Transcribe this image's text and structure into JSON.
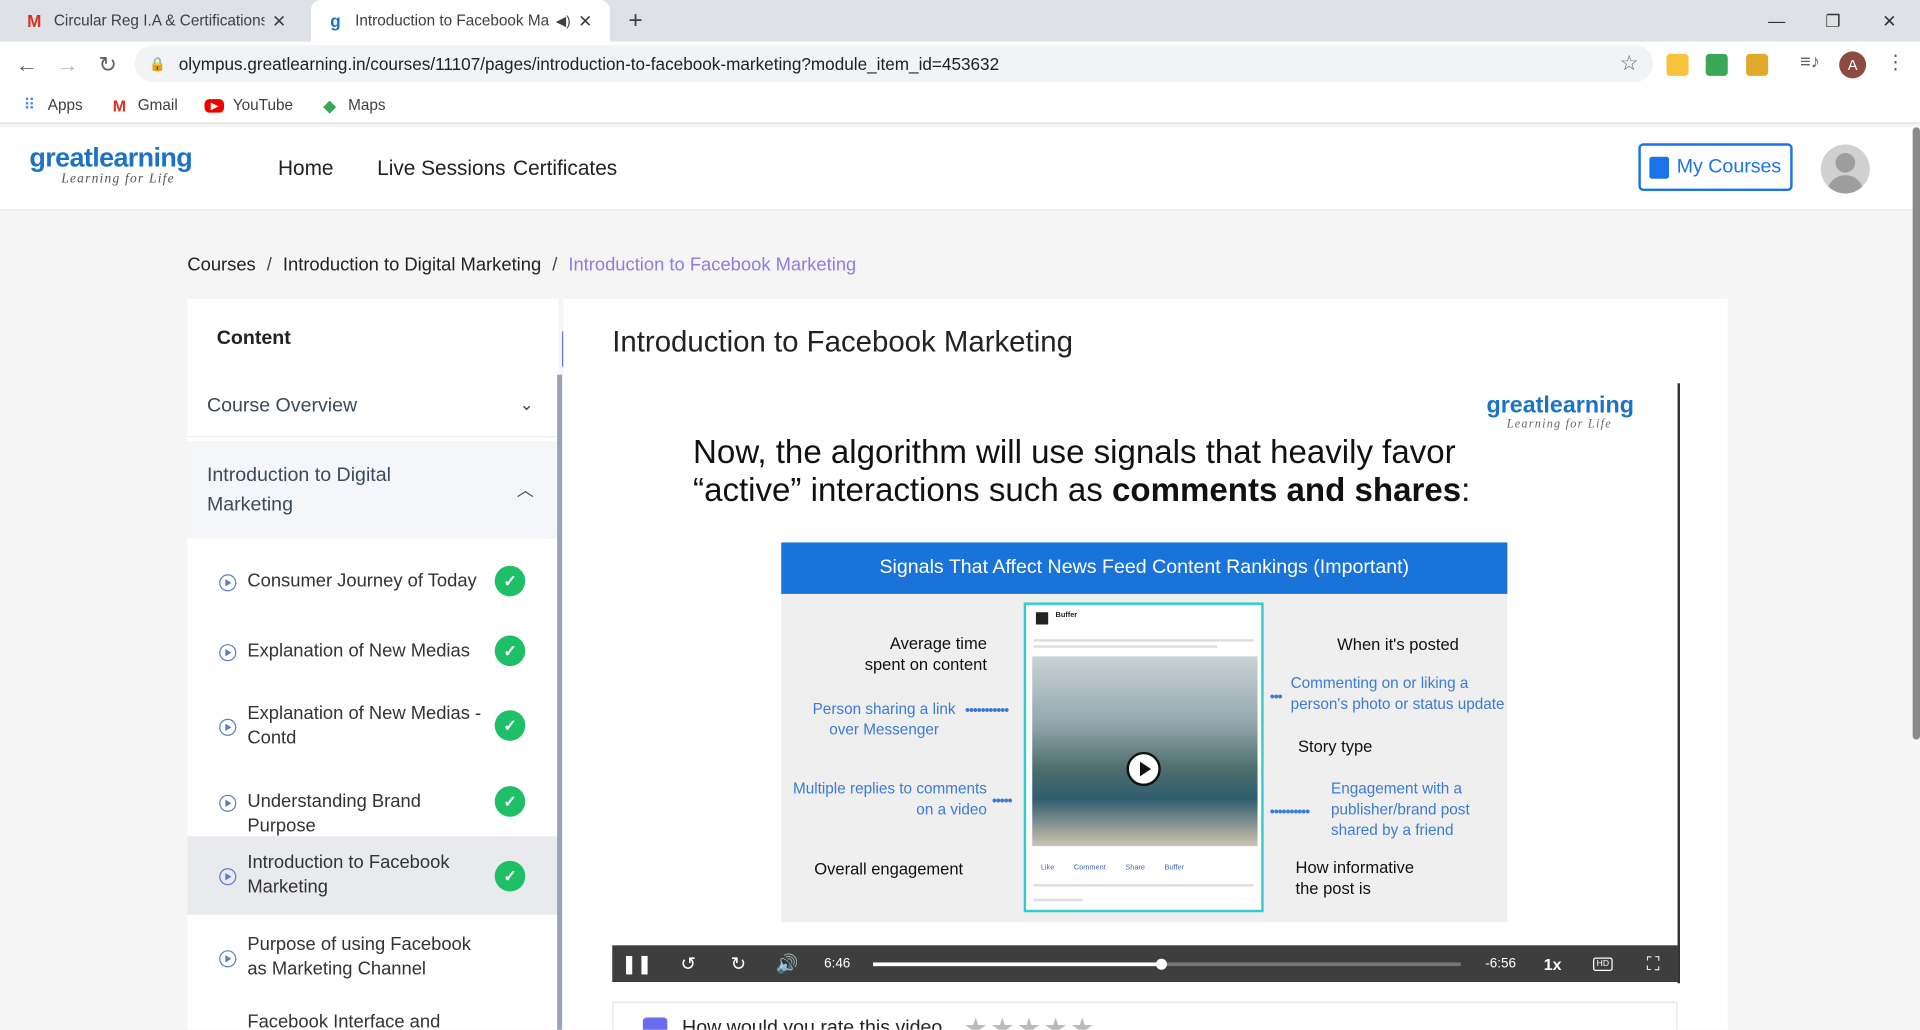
{
  "browser": {
    "tabs": [
      {
        "title": "Circular Reg I.A & Certifications/",
        "icon": "gmail-icon"
      },
      {
        "title": "Introduction to Facebook Ma",
        "icon": "greatlearning-icon",
        "audio": true
      }
    ],
    "new_tab": "+",
    "url": "olympus.greatlearning.in/courses/11107/pages/introduction-to-facebook-marketing?module_item_id=453632",
    "profile_initial": "A",
    "bookmarks": [
      "Apps",
      "Gmail",
      "YouTube",
      "Maps"
    ]
  },
  "site": {
    "logo_main": "greatlearning",
    "logo_tagline": "Learning for Life",
    "nav": [
      "Home",
      "Live Sessions",
      "Certificates"
    ],
    "my_courses": "My Courses"
  },
  "breadcrumb": {
    "root": "Courses",
    "course": "Introduction to Digital Marketing",
    "current": "Introduction to Facebook Marketing",
    "sep": "/"
  },
  "sidebar": {
    "title": "Content",
    "modules": [
      {
        "label": "Course Overview",
        "expanded": false
      },
      {
        "label": "Introduction to Digital Marketing",
        "expanded": true
      }
    ],
    "items": [
      {
        "label": "Consumer Journey of Today",
        "done": true
      },
      {
        "label": "Explanation of New Medias",
        "done": true
      },
      {
        "label": "Explanation of New Medias - Contd",
        "done": true
      },
      {
        "label": "Understanding Brand Purpose",
        "done": true
      },
      {
        "label": "Introduction to Facebook Marketing",
        "done": true,
        "active": true
      },
      {
        "label": "Purpose of using Facebook as Marketing Channel",
        "done": false
      },
      {
        "label": "Facebook Interface and Types of",
        "done": false
      }
    ]
  },
  "lesson": {
    "title": "Introduction to Facebook Marketing"
  },
  "slide": {
    "logo_main": "greatlearning",
    "logo_tagline": "Learning for Life",
    "heading_part1": "Now, the algorithm will use signals that heavily favor “active” interactions such as ",
    "heading_bold": "comments and shares",
    "heading_end": ":",
    "panel_title": "Signals That Affect News Feed Content Rankings (Important)",
    "left_signals": {
      "avg_time": "Average time spent on content",
      "sharing": "Person sharing a link over Messenger",
      "replies": "Multiple replies to comments on a video",
      "overall": "Overall engagement"
    },
    "right_signals": {
      "when": "When it's posted",
      "commenting": "Commenting on or liking a person's photo or status update",
      "story": "Story type",
      "engagement": "Engagement with a publisher/brand post shared by a friend",
      "informative": "How informative the post is"
    },
    "phone": {
      "page": "Buffer",
      "actions": [
        "Like",
        "Comment",
        "Share",
        "Buffer"
      ]
    }
  },
  "player": {
    "elapsed": "6:46",
    "remaining": "-6:56",
    "speed": "1x",
    "progress": 0.49
  },
  "rating": {
    "prompt": "How would you rate this video"
  }
}
